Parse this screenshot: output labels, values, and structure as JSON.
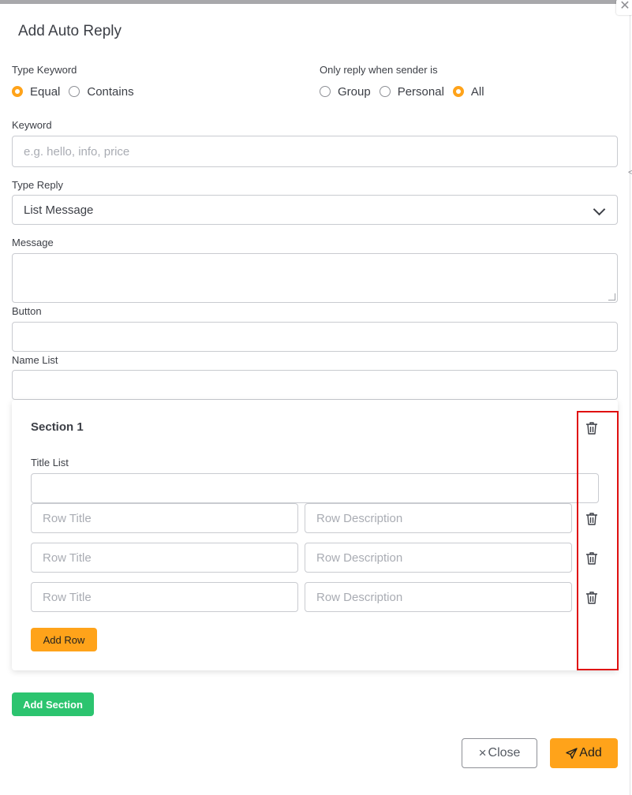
{
  "modal": {
    "title": "Add Auto Reply",
    "close_icon": "close-icon",
    "edge_mark": "<"
  },
  "type_keyword": {
    "label": "Type Keyword",
    "options": [
      "Equal",
      "Contains"
    ],
    "selected": "Equal"
  },
  "sender": {
    "label": "Only reply when sender is",
    "options": [
      "Group",
      "Personal",
      "All"
    ],
    "selected": "All"
  },
  "keyword": {
    "label": "Keyword",
    "placeholder": "e.g. hello, info, price",
    "value": ""
  },
  "type_reply": {
    "label": "Type Reply",
    "selected": "List Message"
  },
  "message": {
    "label": "Message",
    "value": ""
  },
  "button": {
    "label": "Button",
    "value": ""
  },
  "name_list": {
    "label": "Name List",
    "value": ""
  },
  "section": {
    "title": "Section 1",
    "title_list_label": "Title List",
    "title_list_value": "",
    "rows": [
      {
        "title_placeholder": "Row Title",
        "description_placeholder": "Row Description"
      },
      {
        "title_placeholder": "Row Title",
        "description_placeholder": "Row Description"
      },
      {
        "title_placeholder": "Row Title",
        "description_placeholder": "Row Description"
      }
    ],
    "add_row_label": "Add Row"
  },
  "add_section_label": "Add Section",
  "footer": {
    "close_label": "Close",
    "close_icon": "×",
    "add_label": "Add",
    "add_icon": "send-icon"
  },
  "colors": {
    "accent": "#ffa31a",
    "green": "#2cc46f",
    "highlight": "#e01010"
  }
}
